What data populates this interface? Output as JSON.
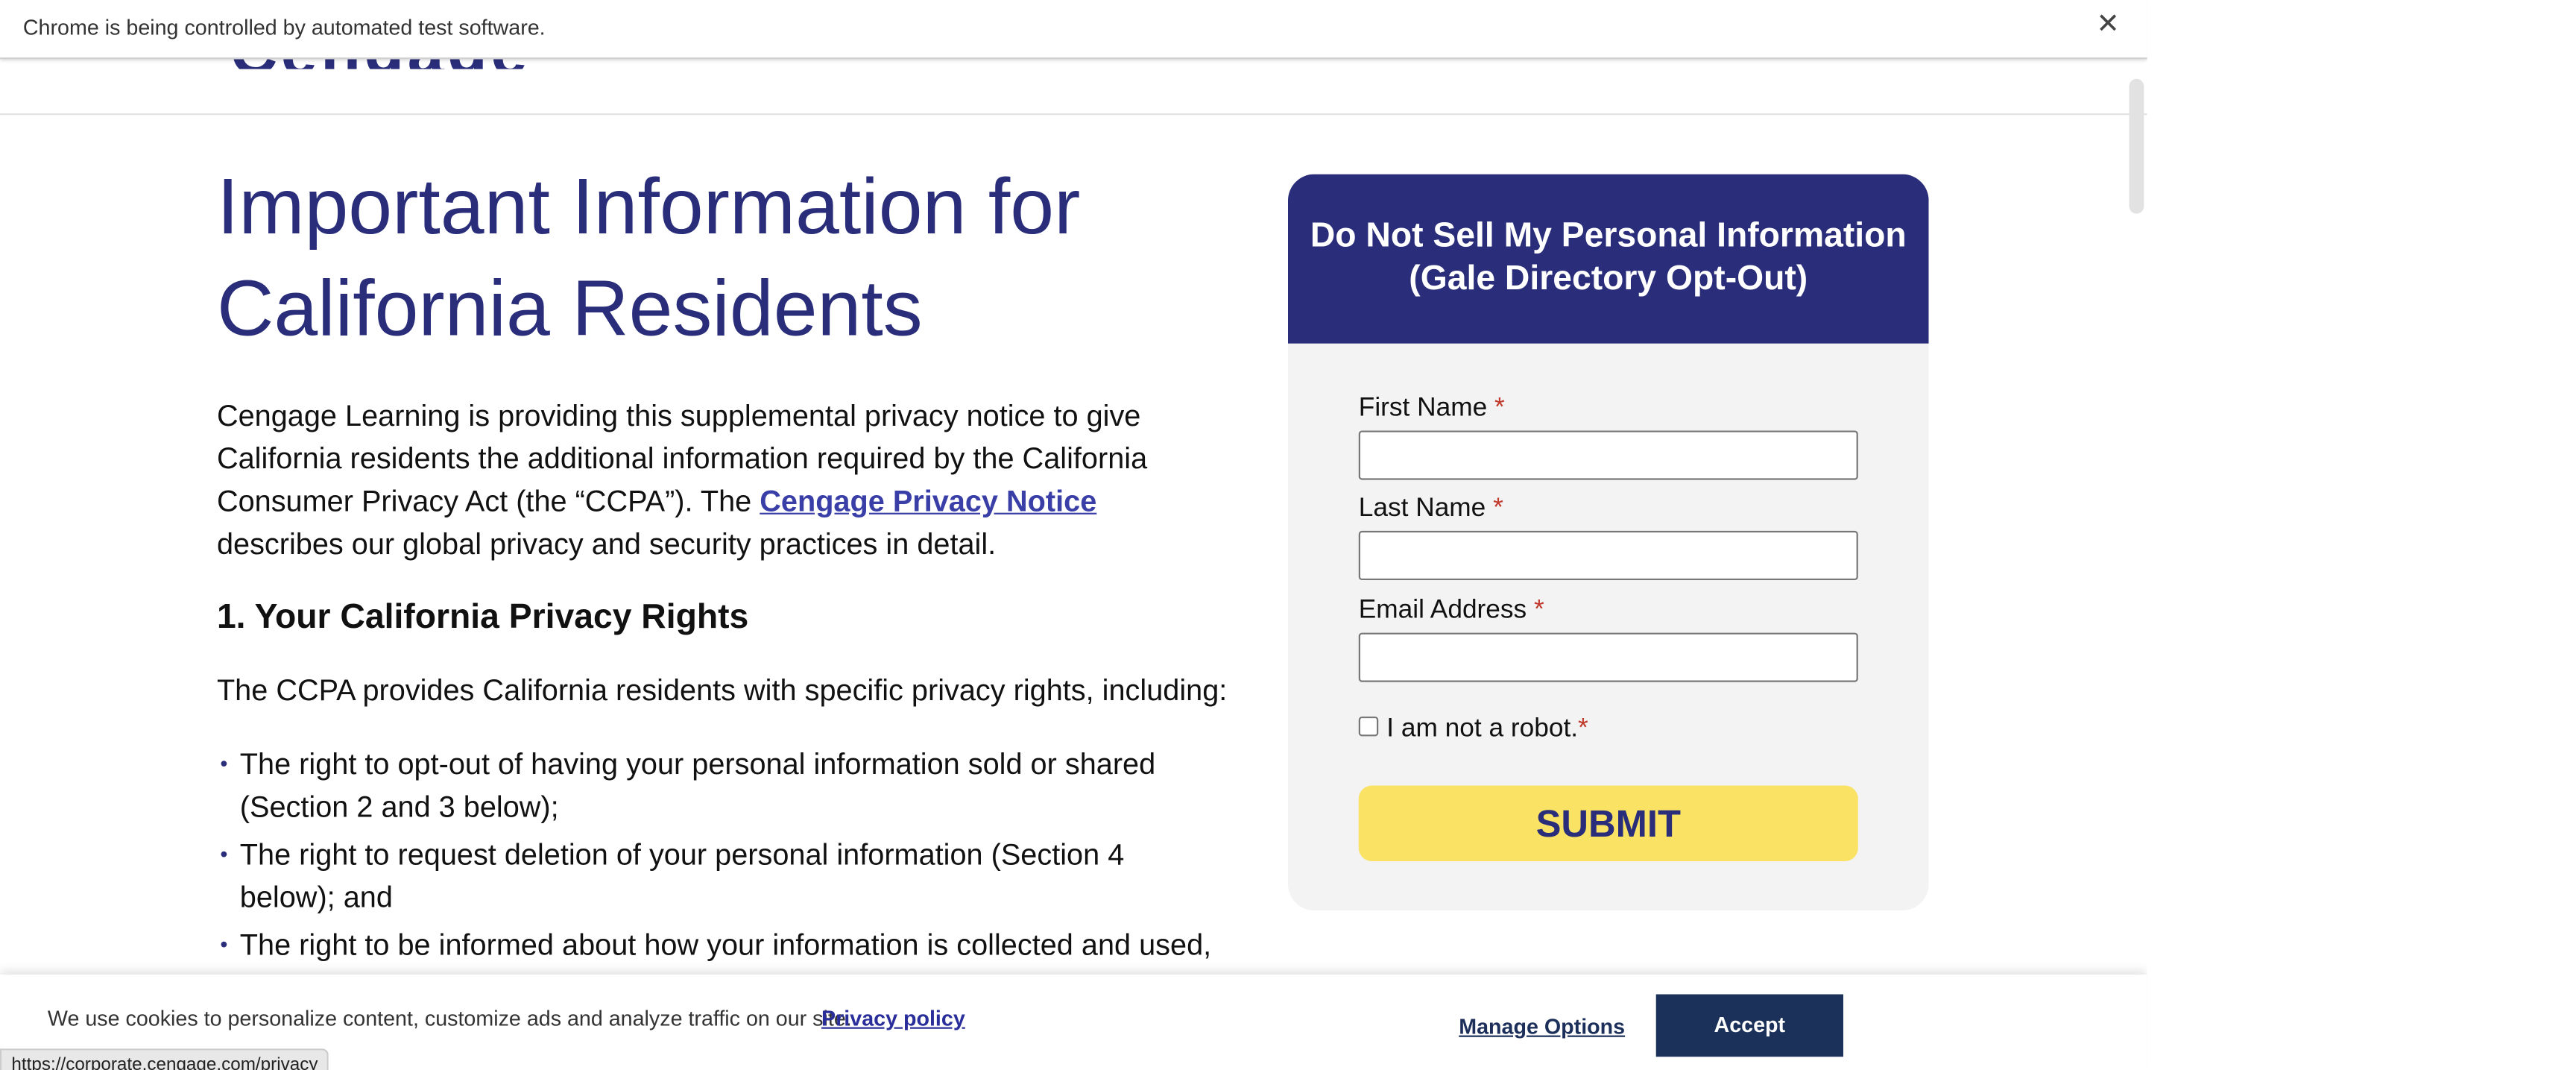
{
  "browser": {
    "automation_notice": "Chrome is being controlled by automated test software.",
    "close_icon": "close-icon",
    "status_url": "https://corporate.cengage.com/privacy"
  },
  "header": {
    "logo_text": "Cengage"
  },
  "main": {
    "title": "Important Information for California Residents",
    "intro_before": "Cengage Learning is providing this supplemental privacy notice to give California residents the additional information required by the California Consumer Privacy Act (the “CCPA”). The ",
    "intro_link": "Cengage Privacy Notice",
    "intro_after": " describes our global privacy and security practices in detail.",
    "section_heading": "1. Your California Privacy Rights",
    "ccpa_lead": "The CCPA provides California residents with specific privacy rights, including:",
    "rights": [
      "The right to opt-out of having your personal information sold or shared (Section 2 and 3 below);",
      "The right to request deletion of your personal information (Section 4 below); and",
      "The right to be informed about how your information is collected and used, the right to know and obtain a copy of the information we have collected about you,"
    ]
  },
  "form": {
    "heading": "Do Not Sell My Personal Information (Gale Directory Opt-Out)",
    "first_name_label": "First Name",
    "last_name_label": "Last Name",
    "email_label": "Email Address",
    "required_mark": "*",
    "robot_label": "I am not a robot.",
    "submit_label": "SUBMIT"
  },
  "cookie_banner": {
    "text": "We use cookies to personalize content, customize ads and analyze traffic on our site.",
    "privacy_link": "Privacy policy",
    "manage_label": "Manage Options",
    "accept_label": "Accept"
  },
  "colors": {
    "brand_navy": "#2a2e7a",
    "submit_yellow": "#f9e264",
    "accept_navy": "#1c3159"
  }
}
